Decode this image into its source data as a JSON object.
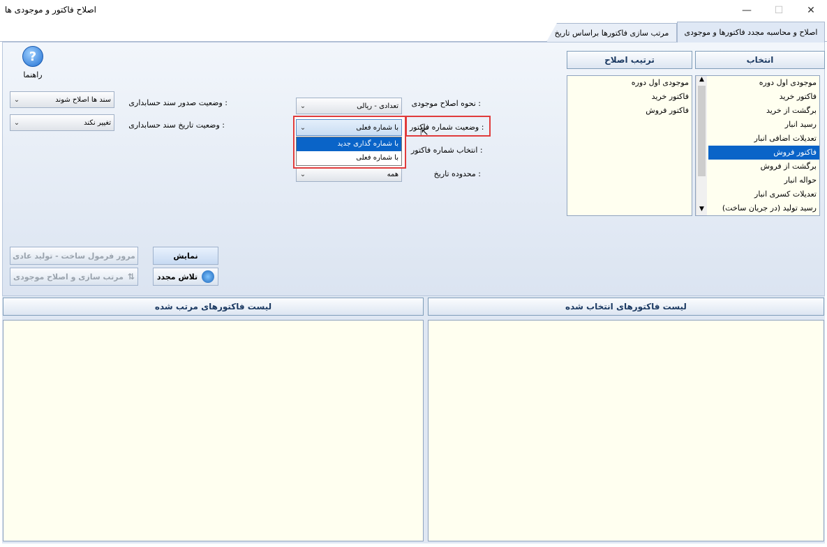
{
  "window": {
    "title": "اصلاح فاکتور و موجودی ها",
    "minimize": "—",
    "maximize": "☐",
    "close": "✕"
  },
  "tabs": [
    {
      "label": "اصلاح و محاسبه مجدد فاکتورها و موجودی"
    },
    {
      "label": "مرتب سازی فاکتورها براساس تاریخ"
    }
  ],
  "help": {
    "label": "راهنما",
    "icon": "?"
  },
  "selection_header": "انتخاب",
  "order_header": "ترتیب اصلاح",
  "selection_list": [
    "موجودی اول دوره",
    "فاکتور خرید",
    "برگشت از خرید",
    "رسید انبار",
    "تعدیلات اضافی انبار",
    "فاکتور فروش",
    "برگشت از فروش",
    "حواله انبار",
    "تعدیلات کسری انبار",
    "رسید تولید (در جریان ساخت)"
  ],
  "selection_selected": "فاکتور فروش",
  "order_list": [
    "موجودی اول دوره",
    "فاکتور خرید",
    "فاکتور فروش"
  ],
  "form": {
    "inventory_method_label": "نحوه اصلاح موجودی :",
    "inventory_method_value": "تعدادی - ریالی",
    "invoice_number_status_label": "وضعیت شماره فاکتور :",
    "invoice_number_status_value": "با شماره فعلی",
    "invoice_number_select_label": "انتخاب شماره فاکتور :",
    "date_range_label": "محدوده تاریخ :",
    "date_range_value": "همه",
    "dropdown_options": [
      "با شماره گذاری جدید",
      "با شماره فعلی"
    ],
    "dropdown_highlighted": "با شماره گذاری جدید",
    "voucher_issue_label": "وضعیت صدور سند حسابداری :",
    "voucher_issue_value": "سند ها اصلاح شوند",
    "voucher_date_label": "وضعیت تاریخ سند حسابداری :",
    "voucher_date_value": "تغییر نکند"
  },
  "buttons": {
    "show": "نمایش",
    "retry": "تلاش مجدد",
    "review_formula": "مرور فرمول ساخت - تولید عادی",
    "sort_fix": "مرتب سازی و اصلاح موجودی"
  },
  "lists": {
    "selected_invoices": "لیست فاکتورهای انتخاب شده",
    "sorted_invoices": "لیست فاکتورهای مرتب شده"
  },
  "colors": {
    "selection_highlight": "#0a64c8",
    "list_background": "#fffff0",
    "annotation_red": "#e03b3b"
  }
}
